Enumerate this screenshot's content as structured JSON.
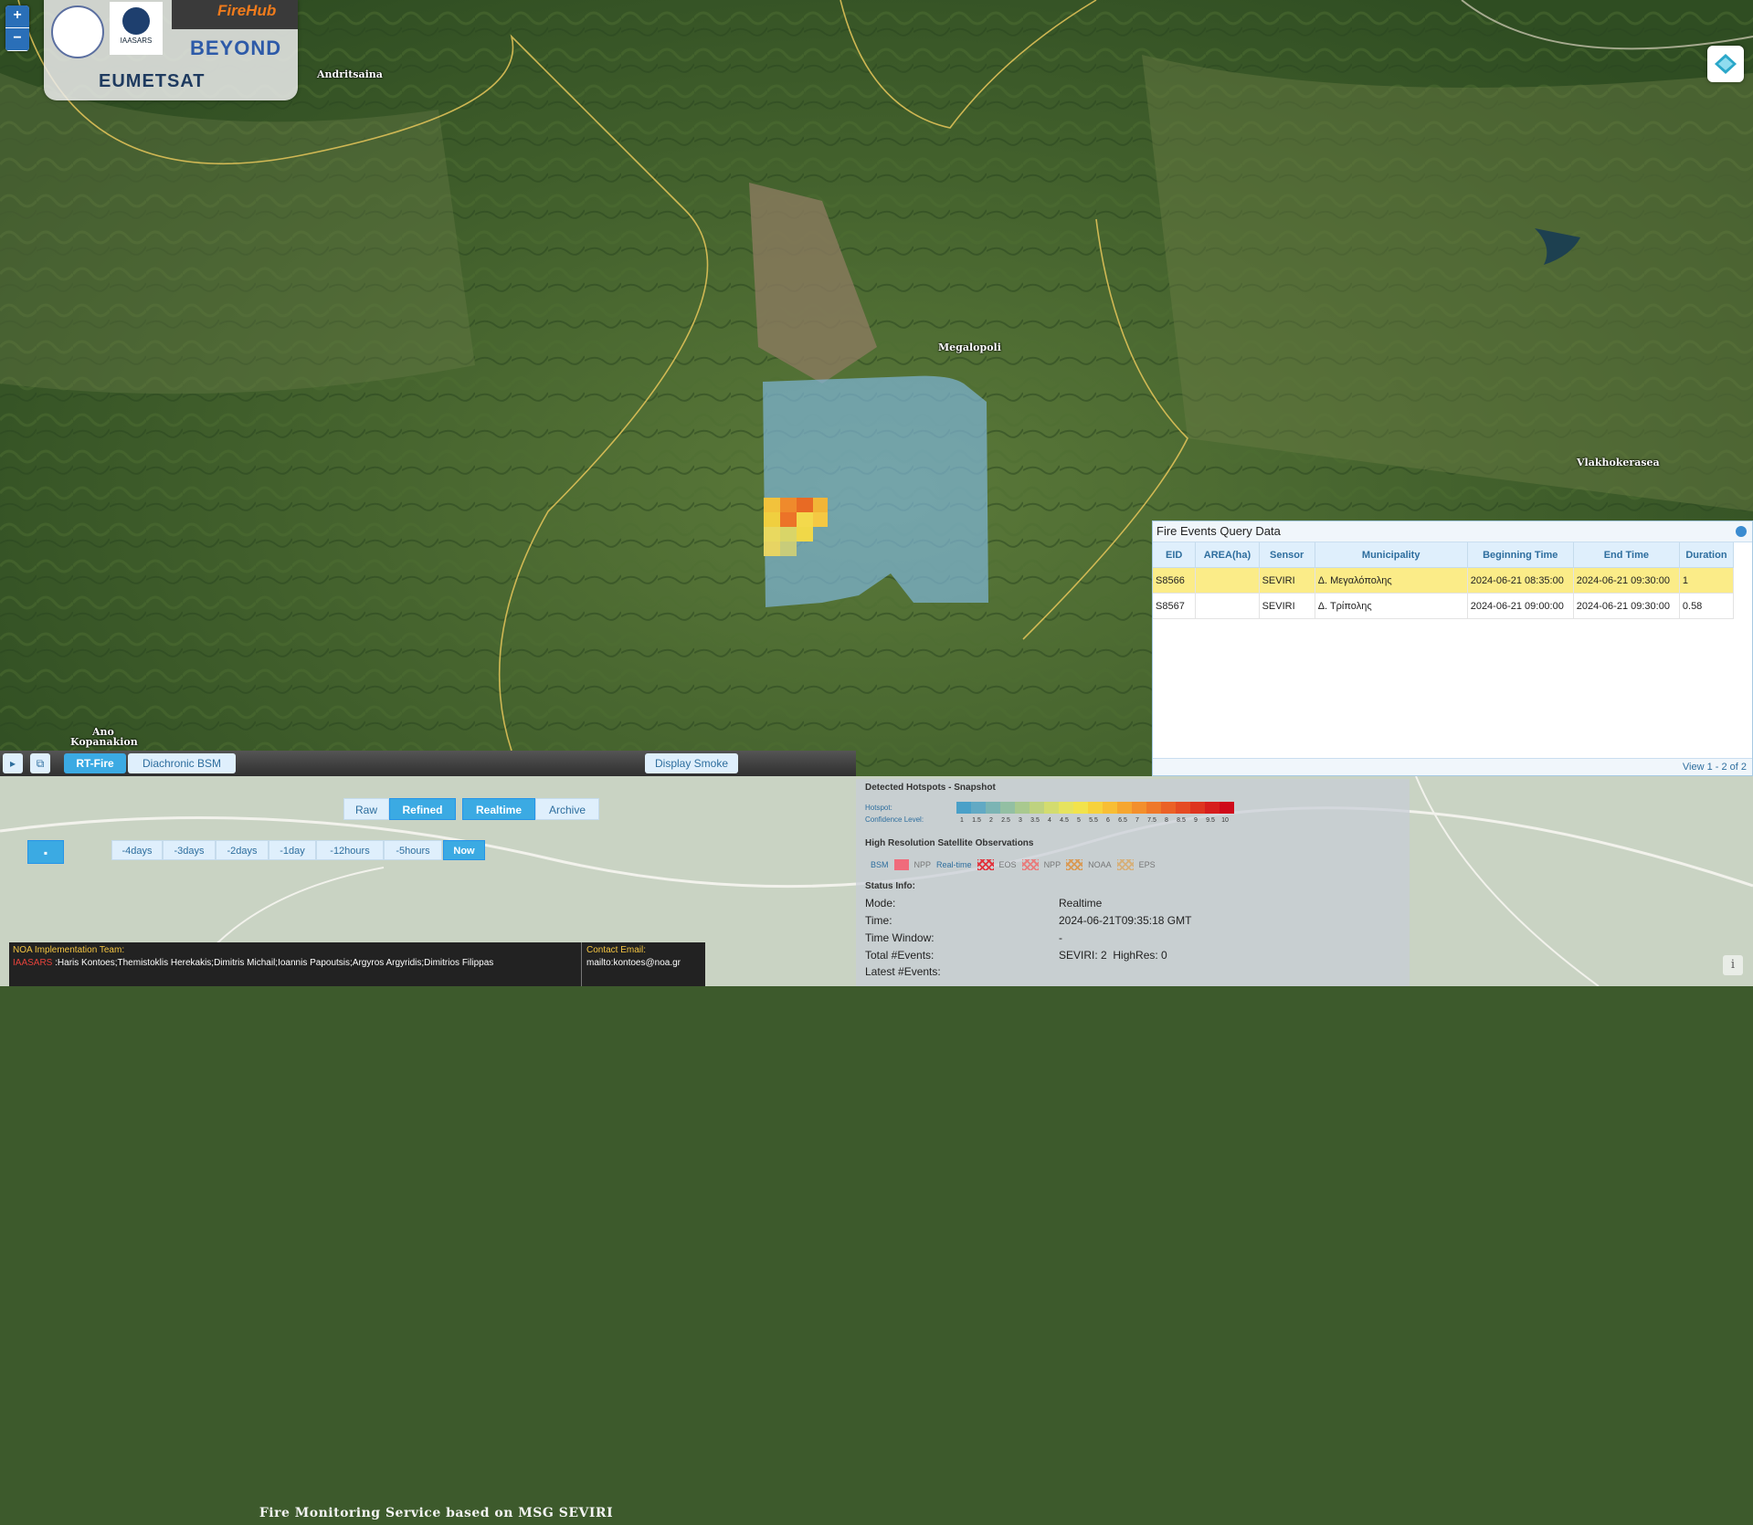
{
  "map": {
    "places": [
      "Andritsaina",
      "Megalopoli",
      "Vlakhokerasea",
      "Ano",
      "Kopanakion"
    ]
  },
  "zoom": {
    "in_label": "+",
    "out_label": "−"
  },
  "logos": {
    "iaasars_label": "IAASARS",
    "firehub_label": "FireHub",
    "beyond_label": "BEYOND",
    "eumetsat_label": "EUMETSAT"
  },
  "fire_panel": {
    "title": "Fire Events Query Data",
    "columns": [
      "EID",
      "AREA(ha)",
      "Sensor",
      "Municipality",
      "Beginning Time",
      "End Time",
      "Duration"
    ],
    "rows": [
      [
        "S8566",
        "",
        "SEVIRI",
        "Δ. Μεγαλόπολης",
        "2024-06-21 08:35:00",
        "2024-06-21 09:30:00",
        "1"
      ],
      [
        "S8567",
        "",
        "SEVIRI",
        "Δ. Τρίπολης",
        "2024-06-21 09:00:00",
        "2024-06-21 09:30:00",
        "0.58"
      ]
    ],
    "pager": "View 1 - 2 of 2"
  },
  "toolbar": {
    "tab_rt": "RT-Fire",
    "tab_bsm": "Diachronic BSM",
    "title": "Fire Monitoring Service based on MSG SEVIRI",
    "smoke": "Display Smoke"
  },
  "mode_buttons": {
    "raw": "Raw",
    "refined": "Refined",
    "realtime": "Realtime",
    "archive": "Archive"
  },
  "time_buttons": [
    "-4days",
    "-3days",
    "-2days",
    "-1day",
    "-12hours",
    "-5hours",
    "Now"
  ],
  "legend": {
    "snapshot_title": "Detected Hotspots - Snapshot",
    "hotspot_label": "Hotspot:",
    "confidence_label": "Confidence Level:",
    "confidence_ticks": [
      "1",
      "1.5",
      "2",
      "2.5",
      "3",
      "3.5",
      "4",
      "4.5",
      "5",
      "5.5",
      "6",
      "6.5",
      "7",
      "7.5",
      "8",
      "8.5",
      "9",
      "9.5",
      "10"
    ],
    "colors": [
      "#4aa0c8",
      "#62a9c4",
      "#7bb4b4",
      "#93bfa3",
      "#a9c98f",
      "#bed27f",
      "#d3dc6f",
      "#e6e35e",
      "#f2e34c",
      "#f7d23b",
      "#f8be34",
      "#f6a62f",
      "#f38f2c",
      "#ef7829",
      "#eb6126",
      "#e54b23",
      "#de3420",
      "#d61e1d",
      "#cf0a1a"
    ],
    "hires_title": "High Resolution Satellite Observations",
    "hires_items": [
      "BSM",
      "NPP",
      "Real-time",
      "EOS",
      "NPP",
      "NOAA",
      "EPS"
    ]
  },
  "status": {
    "title": "Status Info:",
    "rows": [
      {
        "label": "Mode:",
        "value": "Realtime"
      },
      {
        "label": "Time:",
        "value": "2024-06-21T09:35:18 GMT"
      },
      {
        "label": "Time Window:",
        "value": "-"
      },
      {
        "label": "Total #Events:",
        "value": "SEVIRI: 2  HighRes: 0"
      },
      {
        "label": "Latest #Events:",
        "value": ""
      }
    ]
  },
  "team": {
    "heading": "NOA Implementation Team:",
    "org": "IAASARS",
    "members": " :Haris Kontoes;Themistoklis Herekakis;Dimitris Michail;Ioannis Papoutsis;Argyros Argyridis;Dimitrios Filippas",
    "contact_heading": "Contact Email:",
    "contact": "mailto:kontoes@noa.gr"
  }
}
